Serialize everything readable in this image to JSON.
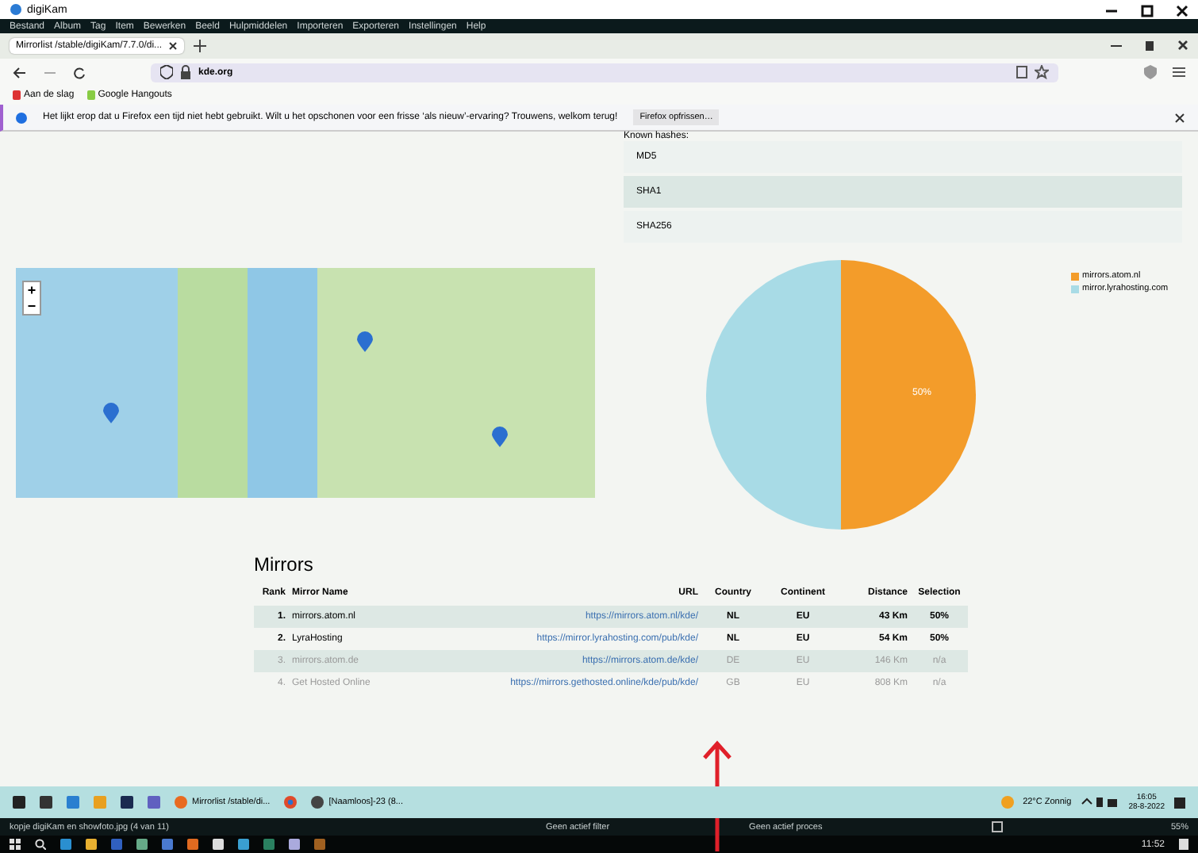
{
  "window": {
    "title": "digiKam"
  },
  "menu": [
    "Bestand",
    "Album",
    "Tag",
    "Item",
    "Bewerken",
    "Beeld",
    "Hulpmiddelen",
    "Importeren",
    "Exporteren",
    "Instellingen",
    "Help"
  ],
  "browser": {
    "tabs": [
      {
        "label": "Mirrorlist /stable/digiKam/7.7.0/di...",
        "selected": true
      }
    ],
    "address": "kde.org",
    "bookmarks": [
      "Aan de slag",
      "Google Hangouts"
    ],
    "notification": {
      "text": "Het lijkt erop dat u Firefox een tijd niet hebt gebruikt. Wilt u het opschonen voor een frisse ‘als nieuw’-ervaring? Trouwens, welkom terug!",
      "button": "Firefox opfrissen…"
    }
  },
  "map": {
    "zoom_in": "+",
    "zoom_out": "−"
  },
  "hashes": {
    "title": "Known hashes:",
    "rows": [
      {
        "name": "MD5"
      },
      {
        "name": "SHA1"
      },
      {
        "name": "SHA256"
      }
    ]
  },
  "chart": {
    "chart_data": {
      "type": "pie",
      "categories": [
        "mirrors.atom.nl",
        "mirror.lyrahosting.com"
      ],
      "series": [
        {
          "values": [
            50,
            50
          ]
        }
      ],
      "colors": [
        "#f39c2a",
        "#a8dbe6"
      ],
      "value_labels": [
        "50%",
        null
      ]
    }
  },
  "mirrors": {
    "title": "Mirrors",
    "columns": [
      "Rank",
      "Mirror Name",
      "URL",
      "Country",
      "Continent",
      "Distance",
      "Selection"
    ],
    "rows": [
      {
        "rank": "1.",
        "name": "mirrors.atom.nl",
        "url": "https://mirrors.atom.nl/kde/",
        "country": "NL",
        "continent": "EU",
        "distance": "43 Km",
        "selection": "50%",
        "disabled": false
      },
      {
        "rank": "2.",
        "name": "LyraHosting",
        "url": "https://mirror.lyrahosting.com/pub/kde/",
        "country": "NL",
        "continent": "EU",
        "distance": "54 Km",
        "selection": "50%",
        "disabled": false
      },
      {
        "rank": "3.",
        "name": "mirrors.atom.de",
        "url": "https://mirrors.atom.de/kde/",
        "country": "DE",
        "continent": "EU",
        "distance": "146 Km",
        "selection": "n/a",
        "disabled": true
      },
      {
        "rank": "4.",
        "name": "Get Hosted Online",
        "url": "https://mirrors.gethosted.online/kde/pub/kde/",
        "country": "GB",
        "continent": "EU",
        "distance": "808 Km",
        "selection": "n/a",
        "disabled": true
      }
    ]
  },
  "image_taskbar": {
    "apps": [
      {
        "label": "Mirrorlist /stable/di..."
      },
      {
        "label": "[Naamloos]-23 (8..."
      }
    ],
    "weather": "22°C Zonnig",
    "time": "16:05",
    "date": "28-8-2022"
  },
  "status_bar": {
    "file": "kopje digiKam en showfoto.jpg (4 van 11)",
    "filter": "Geen actief filter",
    "process": "Geen actief proces",
    "zoom": "55%"
  },
  "os_taskbar": {
    "time": "11:52"
  }
}
